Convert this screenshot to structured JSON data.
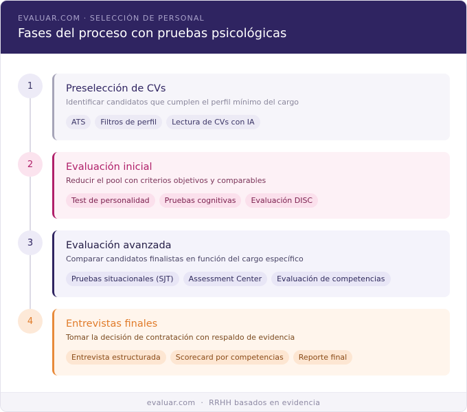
{
  "header": {
    "eyebrow": "EVALUAR.COM · SELECCIÓN DE PERSONAL",
    "title": "Fases del proceso con pruebas psicológicas"
  },
  "phases": [
    {
      "number": "1",
      "title": "Preselección de CVs",
      "description": "Identificar candidatos que cumplen el perfil mínimo del cargo",
      "tags": [
        "ATS",
        "Filtros de perfil",
        "Lectura de CVs con IA"
      ],
      "colors": {
        "accent": "#a6a4b8",
        "title": "#2f2461",
        "desc": "#8a879c",
        "bg": "#f6f5fa",
        "tag_bg": "#eceaf5",
        "tag_text": "#3b3566",
        "num_bg": "#edebf7",
        "num_text": "#3b3566"
      }
    },
    {
      "number": "2",
      "title": "Evaluación inicial",
      "description": "Reducir el pool con criterios objetivos y comparables",
      "tags": [
        "Test de personalidad",
        "Pruebas cognitivas",
        "Evaluación DISC"
      ],
      "colors": {
        "accent": "#b0206a",
        "title": "#b0206a",
        "desc": "#7a3358",
        "bg": "#fdf1f6",
        "tag_bg": "#fbe0ec",
        "tag_text": "#7a1d4c",
        "num_bg": "#fbe3ee",
        "num_text": "#b0206a"
      }
    },
    {
      "number": "3",
      "title": "Evaluación avanzada",
      "description": "Comparar candidatos finalistas en función del cargo específico",
      "tags": [
        "Pruebas situacionales (SJT)",
        "Assessment Center",
        "Evaluación de competencias"
      ],
      "colors": {
        "accent": "#2f2461",
        "title": "#221b44",
        "desc": "#4a4566",
        "bg": "#f4f3fb",
        "tag_bg": "#e8e6f6",
        "tag_text": "#2f2a5c",
        "num_bg": "#edebf7",
        "num_text": "#2f2461"
      }
    },
    {
      "number": "4",
      "title": "Entrevistas finales",
      "description": "Tomar la decisión de contratación con respaldo de evidencia",
      "tags": [
        "Entrevista estructurada",
        "Scorecard por competencias",
        "Reporte final"
      ],
      "colors": {
        "accent": "#e88a3a",
        "title": "#e07b2a",
        "desc": "#7a4a1f",
        "bg": "#fff5ec",
        "tag_bg": "#fde6d2",
        "tag_text": "#8a4b17",
        "num_bg": "#fde9d8",
        "num_text": "#e07b2a"
      }
    }
  ],
  "footer": {
    "site": "evaluar.com",
    "separator": "·",
    "tagline": "RRHH basados en evidencia"
  }
}
